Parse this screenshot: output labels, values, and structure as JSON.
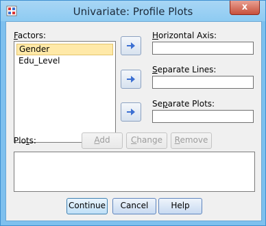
{
  "window": {
    "title": "Univariate: Profile Plots",
    "close_glyph": "x"
  },
  "factors": {
    "label_underline": "F",
    "label_rest": "actors:",
    "items": [
      "Gender",
      "Edu_Level"
    ],
    "selected_index": 0
  },
  "horizontal_axis": {
    "label_underline": "H",
    "label_rest": "orizontal Axis:",
    "value": ""
  },
  "separate_lines": {
    "label_underline": "S",
    "label_rest": "eparate Lines:",
    "value": ""
  },
  "separate_plots": {
    "label_pre": "Se",
    "label_underline": "p",
    "label_rest": "arate Plots:",
    "value": ""
  },
  "plots": {
    "label_pre": "Plo",
    "label_underline": "t",
    "label_rest": "s:",
    "items": []
  },
  "plot_buttons": {
    "add": {
      "underline": "A",
      "rest": "dd"
    },
    "change": {
      "underline": "C",
      "rest": "hange"
    },
    "remove": {
      "underline": "R",
      "rest": "emove"
    }
  },
  "footer": {
    "continue": "Continue",
    "cancel": "Cancel",
    "help": "Help"
  },
  "colors": {
    "accent": "#3c7fb1",
    "selection": "#ffe9a8",
    "arrow": "#3b6fd2"
  },
  "icons": [
    "app-icon",
    "close-icon",
    "arrow-right-icon"
  ]
}
